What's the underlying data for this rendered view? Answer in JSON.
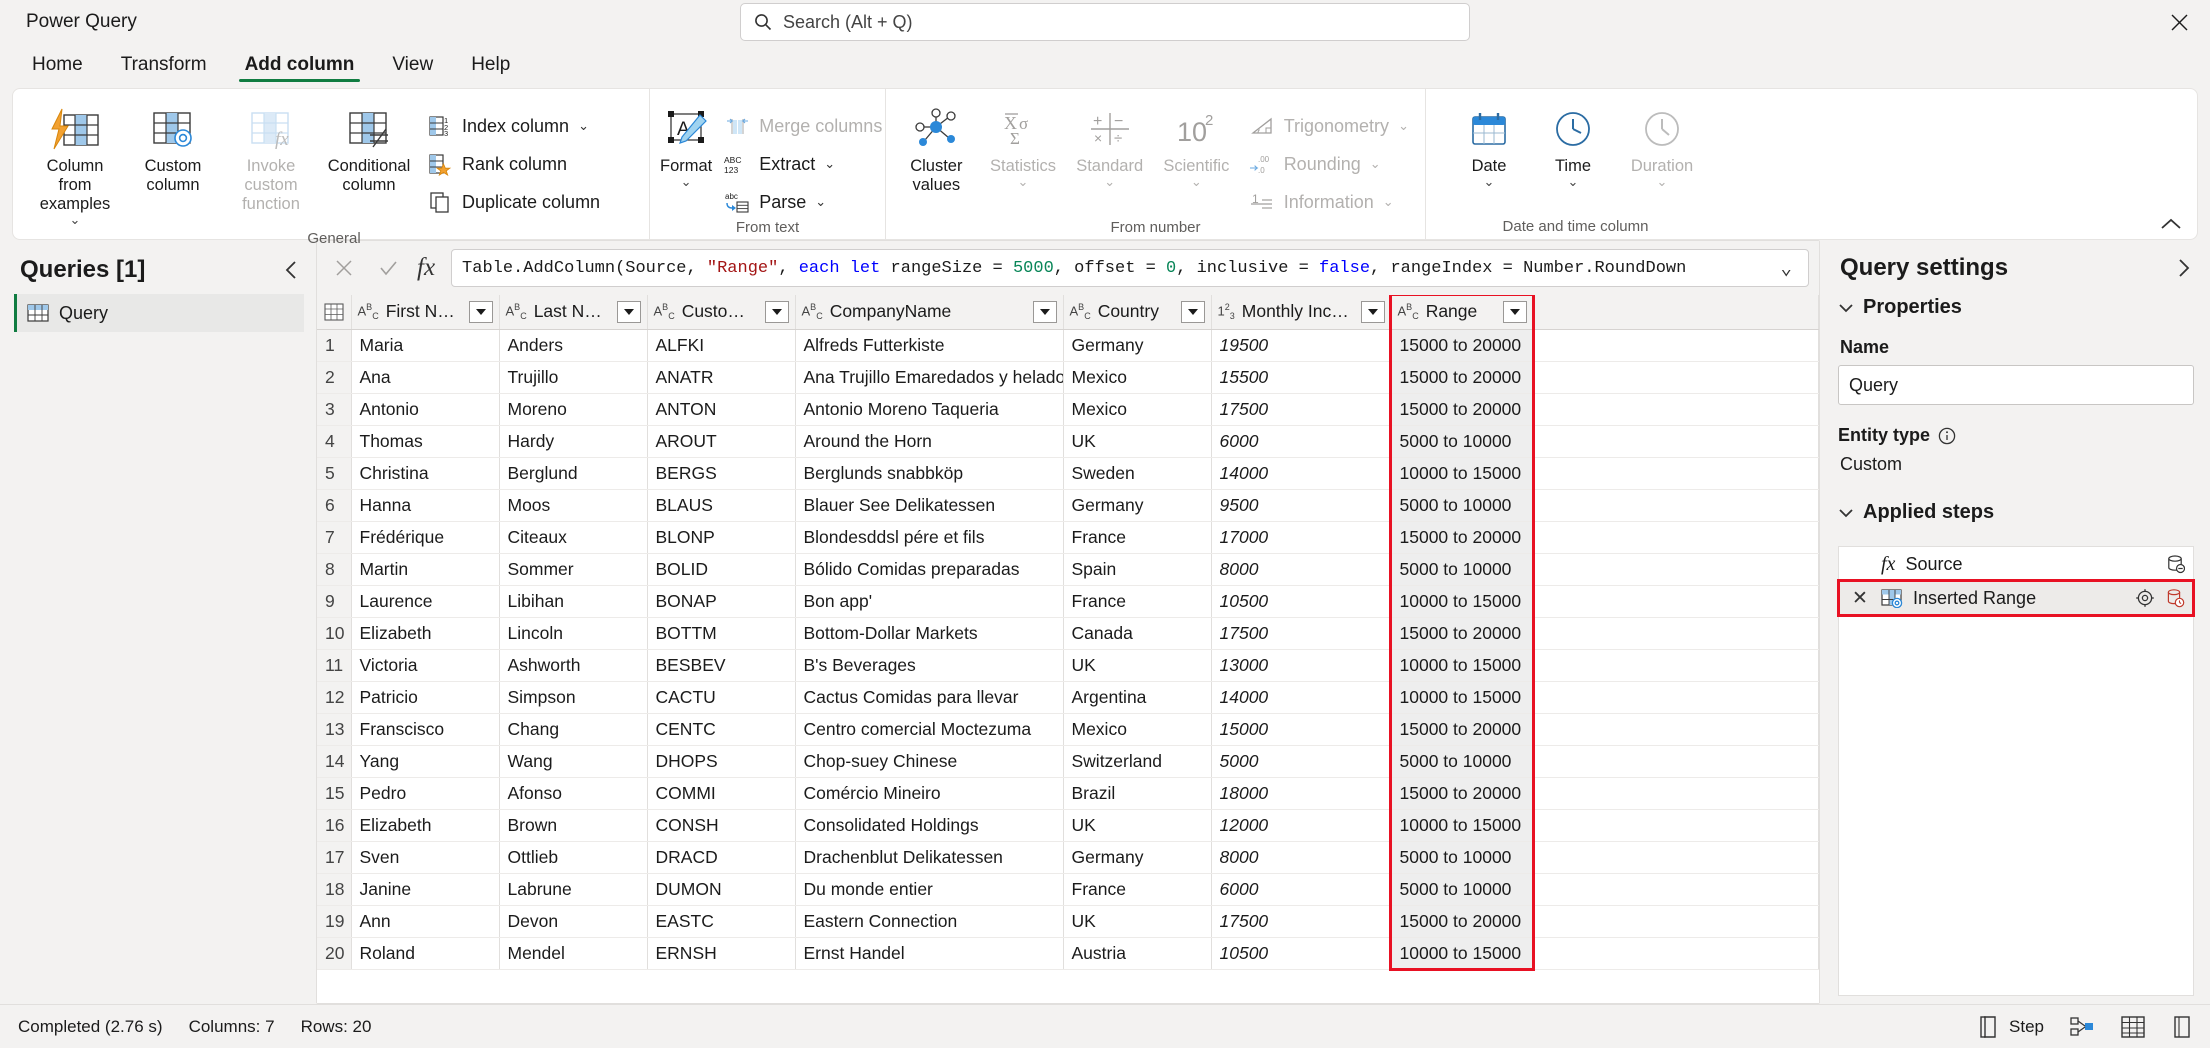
{
  "window": {
    "app_title": "Power Query",
    "close_label": "✕"
  },
  "search": {
    "placeholder": "Search (Alt + Q)",
    "icon": "search-icon"
  },
  "menu": {
    "tabs": [
      {
        "label": "Home",
        "active": false
      },
      {
        "label": "Transform",
        "active": false
      },
      {
        "label": "Add column",
        "active": true
      },
      {
        "label": "View",
        "active": false
      },
      {
        "label": "Help",
        "active": false
      }
    ]
  },
  "ribbon": {
    "collapse_icon": "chevron-up-icon",
    "groups": [
      {
        "name": "General",
        "label": "General",
        "big_buttons": [
          {
            "label": "Column from examples",
            "icon": "column-from-examples-icon",
            "has_chevron": true,
            "disabled": false
          },
          {
            "label": "Custom column",
            "icon": "custom-column-icon",
            "has_chevron": false,
            "disabled": false
          },
          {
            "label": "Invoke custom function",
            "icon": "invoke-custom-function-icon",
            "has_chevron": false,
            "disabled": true
          },
          {
            "label": "Conditional column",
            "icon": "conditional-column-icon",
            "has_chevron": false,
            "disabled": false
          }
        ],
        "small_buttons": [
          {
            "label": "Index column",
            "icon": "index-column-icon",
            "has_chevron": true,
            "disabled": false
          },
          {
            "label": "Rank column",
            "icon": "rank-column-icon",
            "has_chevron": false,
            "disabled": false
          },
          {
            "label": "Duplicate column",
            "icon": "duplicate-column-icon",
            "has_chevron": false,
            "disabled": false
          }
        ]
      },
      {
        "name": "From text",
        "label": "From text",
        "big_buttons": [
          {
            "label": "Format",
            "icon": "format-icon",
            "has_chevron": true,
            "disabled": false
          }
        ],
        "small_buttons": [
          {
            "label": "Merge columns",
            "icon": "merge-columns-icon",
            "has_chevron": false,
            "disabled": true
          },
          {
            "label": "Extract",
            "icon": "extract-abc123-icon",
            "has_chevron": true,
            "disabled": false
          },
          {
            "label": "Parse",
            "icon": "parse-icon",
            "has_chevron": true,
            "disabled": false
          }
        ]
      },
      {
        "name": "From number",
        "label": "From number",
        "big_buttons": [
          {
            "label": "Cluster values",
            "icon": "cluster-values-icon",
            "has_chevron": false,
            "disabled": false
          },
          {
            "label": "Statistics",
            "icon": "statistics-icon",
            "has_chevron": true,
            "disabled": true
          },
          {
            "label": "Standard",
            "icon": "standard-icon",
            "has_chevron": true,
            "disabled": true
          },
          {
            "label": "Scientific",
            "icon": "scientific-icon",
            "has_chevron": true,
            "disabled": true
          }
        ],
        "small_buttons": [
          {
            "label": "Trigonometry",
            "icon": "trigonometry-icon",
            "has_chevron": true,
            "disabled": true
          },
          {
            "label": "Rounding",
            "icon": "rounding-icon",
            "has_chevron": true,
            "disabled": true
          },
          {
            "label": "Information",
            "icon": "information-icon",
            "has_chevron": true,
            "disabled": true
          }
        ]
      },
      {
        "name": "Date and time column",
        "label": "Date and time column",
        "big_buttons": [
          {
            "label": "Date",
            "icon": "date-icon",
            "has_chevron": true,
            "disabled": false
          },
          {
            "label": "Time",
            "icon": "time-icon",
            "has_chevron": true,
            "disabled": false
          },
          {
            "label": "Duration",
            "icon": "duration-icon",
            "has_chevron": true,
            "disabled": true
          }
        ],
        "small_buttons": []
      }
    ]
  },
  "queries_pane": {
    "title": "Queries [1]",
    "collapse_icon": "chevron-left-icon",
    "items": [
      {
        "label": "Query",
        "icon": "table-icon",
        "selected": true
      }
    ]
  },
  "formula_bar": {
    "cancel_icon": "close-icon",
    "accept_icon": "check-icon",
    "fx_label": "fx",
    "expand_icon": "chevron-down-icon",
    "tokens": [
      {
        "t": "Table.AddColumn(Source, ",
        "k": "plain"
      },
      {
        "t": "\"Range\"",
        "k": "str"
      },
      {
        "t": ", ",
        "k": "plain"
      },
      {
        "t": "each",
        "k": "kw"
      },
      {
        "t": " ",
        "k": "plain"
      },
      {
        "t": "let",
        "k": "kw"
      },
      {
        "t": " rangeSize = ",
        "k": "plain"
      },
      {
        "t": "5000",
        "k": "num"
      },
      {
        "t": ", offset = ",
        "k": "plain"
      },
      {
        "t": "0",
        "k": "num"
      },
      {
        "t": ", inclusive = ",
        "k": "plain"
      },
      {
        "t": "false",
        "k": "kw"
      },
      {
        "t": ", rangeIndex = Number.RoundDown",
        "k": "plain"
      }
    ],
    "full_text": "Table.AddColumn(Source, \"Range\", each let rangeSize = 5000, offset = 0, inclusive = false, rangeIndex = Number.RoundDown"
  },
  "grid": {
    "columns": [
      {
        "name": "First Name",
        "type_icon": "ABC",
        "selected": false,
        "align": "left"
      },
      {
        "name": "Last Name",
        "type_icon": "ABC",
        "selected": false,
        "align": "left"
      },
      {
        "name": "CustomerID",
        "type_icon": "ABC",
        "selected": false,
        "align": "left"
      },
      {
        "name": "CompanyName",
        "type_icon": "ABC",
        "selected": false,
        "align": "left"
      },
      {
        "name": "Country",
        "type_icon": "ABC",
        "selected": false,
        "align": "left"
      },
      {
        "name": "Monthly Income",
        "type_icon": "123",
        "selected": false,
        "align": "right"
      },
      {
        "name": "Range",
        "type_icon": "ABC",
        "selected": true,
        "align": "left"
      }
    ],
    "rows": [
      {
        "n": 1,
        "cells": [
          "Maria",
          "Anders",
          "ALFKI",
          "Alfreds Futterkiste",
          "Germany",
          "19500",
          "15000 to 20000"
        ]
      },
      {
        "n": 2,
        "cells": [
          "Ana",
          "Trujillo",
          "ANATR",
          "Ana Trujillo Emaredados y helados",
          "Mexico",
          "15500",
          "15000 to 20000"
        ]
      },
      {
        "n": 3,
        "cells": [
          "Antonio",
          "Moreno",
          "ANTON",
          "Antonio Moreno Taqueria",
          "Mexico",
          "17500",
          "15000 to 20000"
        ]
      },
      {
        "n": 4,
        "cells": [
          "Thomas",
          "Hardy",
          "AROUT",
          "Around the Horn",
          "UK",
          "6000",
          "5000 to 10000"
        ]
      },
      {
        "n": 5,
        "cells": [
          "Christina",
          "Berglund",
          "BERGS",
          "Berglunds snabbköp",
          "Sweden",
          "14000",
          "10000 to 15000"
        ]
      },
      {
        "n": 6,
        "cells": [
          "Hanna",
          "Moos",
          "BLAUS",
          "Blauer See Delikatessen",
          "Germany",
          "9500",
          "5000 to 10000"
        ]
      },
      {
        "n": 7,
        "cells": [
          "Frédérique",
          "Citeaux",
          "BLONP",
          "Blondesddsl pére et fils",
          "France",
          "17000",
          "15000 to 20000"
        ]
      },
      {
        "n": 8,
        "cells": [
          "Martin",
          "Sommer",
          "BOLID",
          "Bólido Comidas preparadas",
          "Spain",
          "8000",
          "5000 to 10000"
        ]
      },
      {
        "n": 9,
        "cells": [
          "Laurence",
          "Libihan",
          "BONAP",
          "Bon app'",
          "France",
          "10500",
          "10000 to 15000"
        ]
      },
      {
        "n": 10,
        "cells": [
          "Elizabeth",
          "Lincoln",
          "BOTTM",
          "Bottom-Dollar Markets",
          "Canada",
          "17500",
          "15000 to 20000"
        ]
      },
      {
        "n": 11,
        "cells": [
          "Victoria",
          "Ashworth",
          "BESBEV",
          "B's Beverages",
          "UK",
          "13000",
          "10000 to 15000"
        ]
      },
      {
        "n": 12,
        "cells": [
          "Patricio",
          "Simpson",
          "CACTU",
          "Cactus Comidas para llevar",
          "Argentina",
          "14000",
          "10000 to 15000"
        ]
      },
      {
        "n": 13,
        "cells": [
          "Franscisco",
          "Chang",
          "CENTC",
          "Centro comercial Moctezuma",
          "Mexico",
          "15000",
          "15000 to 20000"
        ]
      },
      {
        "n": 14,
        "cells": [
          "Yang",
          "Wang",
          "DHOPS",
          "Chop-suey Chinese",
          "Switzerland",
          "5000",
          "5000 to 10000"
        ]
      },
      {
        "n": 15,
        "cells": [
          "Pedro",
          "Afonso",
          "COMMI",
          "Comércio Mineiro",
          "Brazil",
          "18000",
          "15000 to 20000"
        ]
      },
      {
        "n": 16,
        "cells": [
          "Elizabeth",
          "Brown",
          "CONSH",
          "Consolidated Holdings",
          "UK",
          "12000",
          "10000 to 15000"
        ]
      },
      {
        "n": 17,
        "cells": [
          "Sven",
          "Ottlieb",
          "DRACD",
          "Drachenblut Delikatessen",
          "Germany",
          "8000",
          "5000 to 10000"
        ]
      },
      {
        "n": 18,
        "cells": [
          "Janine",
          "Labrune",
          "DUMON",
          "Du monde entier",
          "France",
          "6000",
          "5000 to 10000"
        ]
      },
      {
        "n": 19,
        "cells": [
          "Ann",
          "Devon",
          "EASTC",
          "Eastern Connection",
          "UK",
          "17500",
          "15000 to 20000"
        ]
      },
      {
        "n": 20,
        "cells": [
          "Roland",
          "Mendel",
          "ERNSH",
          "Ernst Handel",
          "Austria",
          "10500",
          "10000 to 15000"
        ]
      }
    ]
  },
  "query_settings": {
    "title": "Query settings",
    "expand_icon": "chevron-right-icon",
    "properties_label": "Properties",
    "name_label": "Name",
    "name_value": "Query",
    "entity_type_label": "Entity type",
    "entity_type_info_icon": "info-icon",
    "entity_type_value": "Custom",
    "applied_steps_label": "Applied steps",
    "steps": [
      {
        "label": "Source",
        "icon": "fx-icon",
        "selected": false,
        "has_delete": false,
        "has_gear": false,
        "has_source_icon": true
      },
      {
        "label": "Inserted Range",
        "icon": "inserted-range-icon",
        "selected": true,
        "has_delete": true,
        "has_gear": true,
        "has_source_icon": true
      }
    ]
  },
  "status_bar": {
    "completed": "Completed (2.76 s)",
    "columns": "Columns: 7",
    "rows": "Rows: 20",
    "step_label": "Step",
    "icons": [
      "step-icon",
      "diagram-view-icon",
      "data-view-icon",
      "schema-view-icon"
    ]
  },
  "colors": {
    "accent_green": "#107c41",
    "selection_teal": "#9fd9cd",
    "highlight_red": "#e81123",
    "chrome_bg": "#f3f2f1"
  }
}
